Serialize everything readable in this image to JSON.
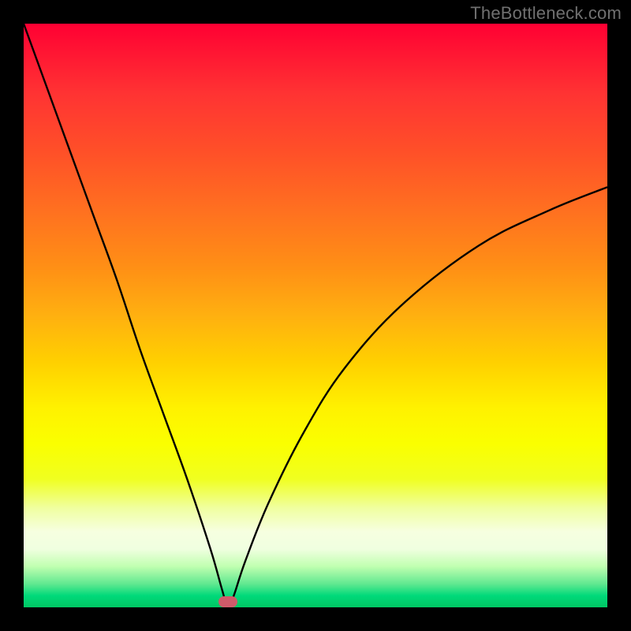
{
  "attribution": "TheBottleneck.com",
  "chart_data": {
    "type": "line",
    "title": "",
    "xlabel": "",
    "ylabel": "",
    "xlim": [
      0,
      100
    ],
    "ylim": [
      0,
      100
    ],
    "series": [
      {
        "name": "bottleneck-curve",
        "x": [
          0,
          4,
          8,
          12,
          16,
          20,
          24,
          28,
          32,
          34,
          35,
          36,
          38,
          42,
          48,
          55,
          65,
          78,
          90,
          100
        ],
        "values": [
          100,
          89,
          78,
          67,
          56,
          44,
          33,
          22,
          10,
          3,
          0,
          2,
          8,
          18,
          30,
          41,
          52,
          62,
          68,
          72
        ]
      }
    ],
    "marker": {
      "x": 35,
      "y": 1
    },
    "legend": false,
    "grid": false
  },
  "colors": {
    "curve": "#000000",
    "marker": "#cf5b6a",
    "frame": "#000000"
  }
}
